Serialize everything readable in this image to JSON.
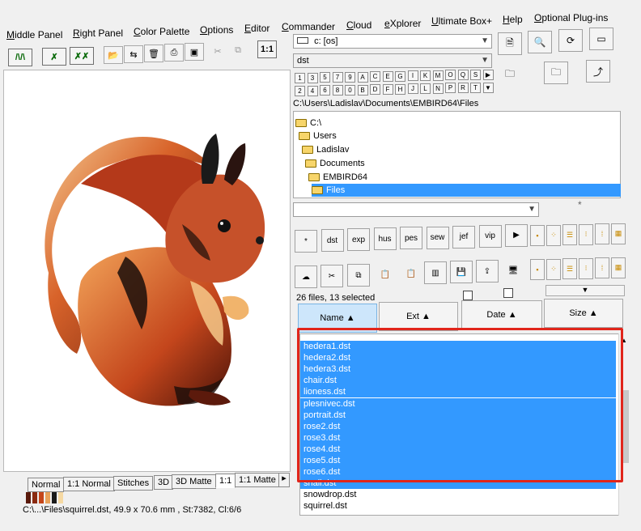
{
  "menu": [
    "Middle Panel",
    "Right Panel",
    "Color Palette",
    "Options",
    "Editor",
    "Commander",
    "Cloud",
    "eXplorer",
    "Ultimate Box+",
    "Help",
    "Optional Plug-ins"
  ],
  "left_toolbar": {
    "ratio_label": "1:1"
  },
  "drive_combo": "c: [os]",
  "filter_combo": "dst",
  "keys_row1": [
    "1",
    "3",
    "5",
    "7",
    "9",
    "A",
    "C",
    "E",
    "G",
    "I",
    "K",
    "M",
    "O",
    "Q",
    "S"
  ],
  "keys_row2": [
    "2",
    "4",
    "6",
    "8",
    "0",
    "B",
    "D",
    "F",
    "H",
    "J",
    "L",
    "N",
    "P",
    "R",
    "T"
  ],
  "current_path": "C:\\Users\\Ladislav\\Documents\\EMBIRD64\\Files",
  "tree": [
    "C:\\",
    "Users",
    "Ladislav",
    "Documents",
    "EMBIRD64",
    "Files"
  ],
  "tree_selected_index": 5,
  "wildcard": "*",
  "format_buttons": [
    "*",
    "dst",
    "exp",
    "hus",
    "pes",
    "sew",
    "jef",
    "vip"
  ],
  "files_count": "26 files, 13 selected",
  "columns": [
    "Name",
    "Ext",
    "Date",
    "Size"
  ],
  "files": [
    {
      "name": "hedera1.dst",
      "selected": true
    },
    {
      "name": "hedera2.dst",
      "selected": true
    },
    {
      "name": "hedera3.dst",
      "selected": true
    },
    {
      "name": "chair.dst",
      "selected": true
    },
    {
      "name": "lioness.dst",
      "selected": true
    },
    {
      "name": "plesnivec.dst",
      "selected": true
    },
    {
      "name": "portrait.dst",
      "selected": true
    },
    {
      "name": "rose2.dst",
      "selected": true
    },
    {
      "name": "rose3.dst",
      "selected": true
    },
    {
      "name": "rose4.dst",
      "selected": true
    },
    {
      "name": "rose5.dst",
      "selected": true
    },
    {
      "name": "rose6.dst",
      "selected": true
    },
    {
      "name": "snail.dst",
      "selected": true
    },
    {
      "name": "snowdrop.dst",
      "selected": false
    },
    {
      "name": "squirrel.dst",
      "selected": false
    }
  ],
  "view_tabs": [
    "Normal",
    "1:1 Normal",
    "Stitches",
    "3D",
    "3D Matte",
    "1:1",
    "1:1 Matte"
  ],
  "active_tab_index": 5,
  "status": "C:\\...\\Files\\squirrel.dst, 49.9 x 70.6 mm , St:7382, Cl:6/6",
  "palette_colors": [
    "#5a1a0c",
    "#8a2a10",
    "#c5461a",
    "#e8a25a",
    "#1a1a1a",
    "#f6d9a3"
  ],
  "colors": {
    "selection": "#3399ff",
    "highlight_border": "#e1251b"
  }
}
